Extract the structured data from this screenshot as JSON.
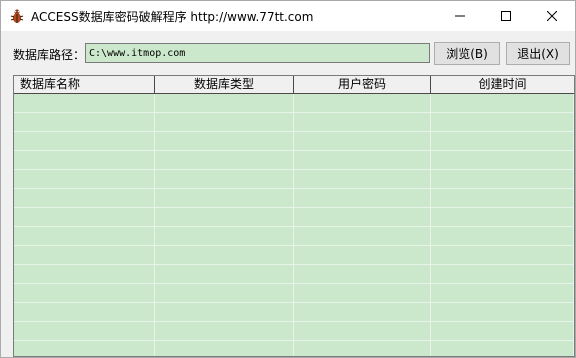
{
  "window": {
    "title": "ACCESS数据库密码破解程序 http://www.77tt.com",
    "icon": "bug-app-icon"
  },
  "path_row": {
    "label": "数据库路径：",
    "value": "C:\\www.itmop.com",
    "browse_label": "浏览(B)",
    "exit_label": "退出(X)"
  },
  "grid": {
    "columns": [
      "数据库名称",
      "数据库类型",
      "用户密码",
      "创建时间"
    ],
    "row_count": 14
  },
  "colors": {
    "grid_background": "#cce8cc",
    "window_background": "#f0f0f0"
  }
}
